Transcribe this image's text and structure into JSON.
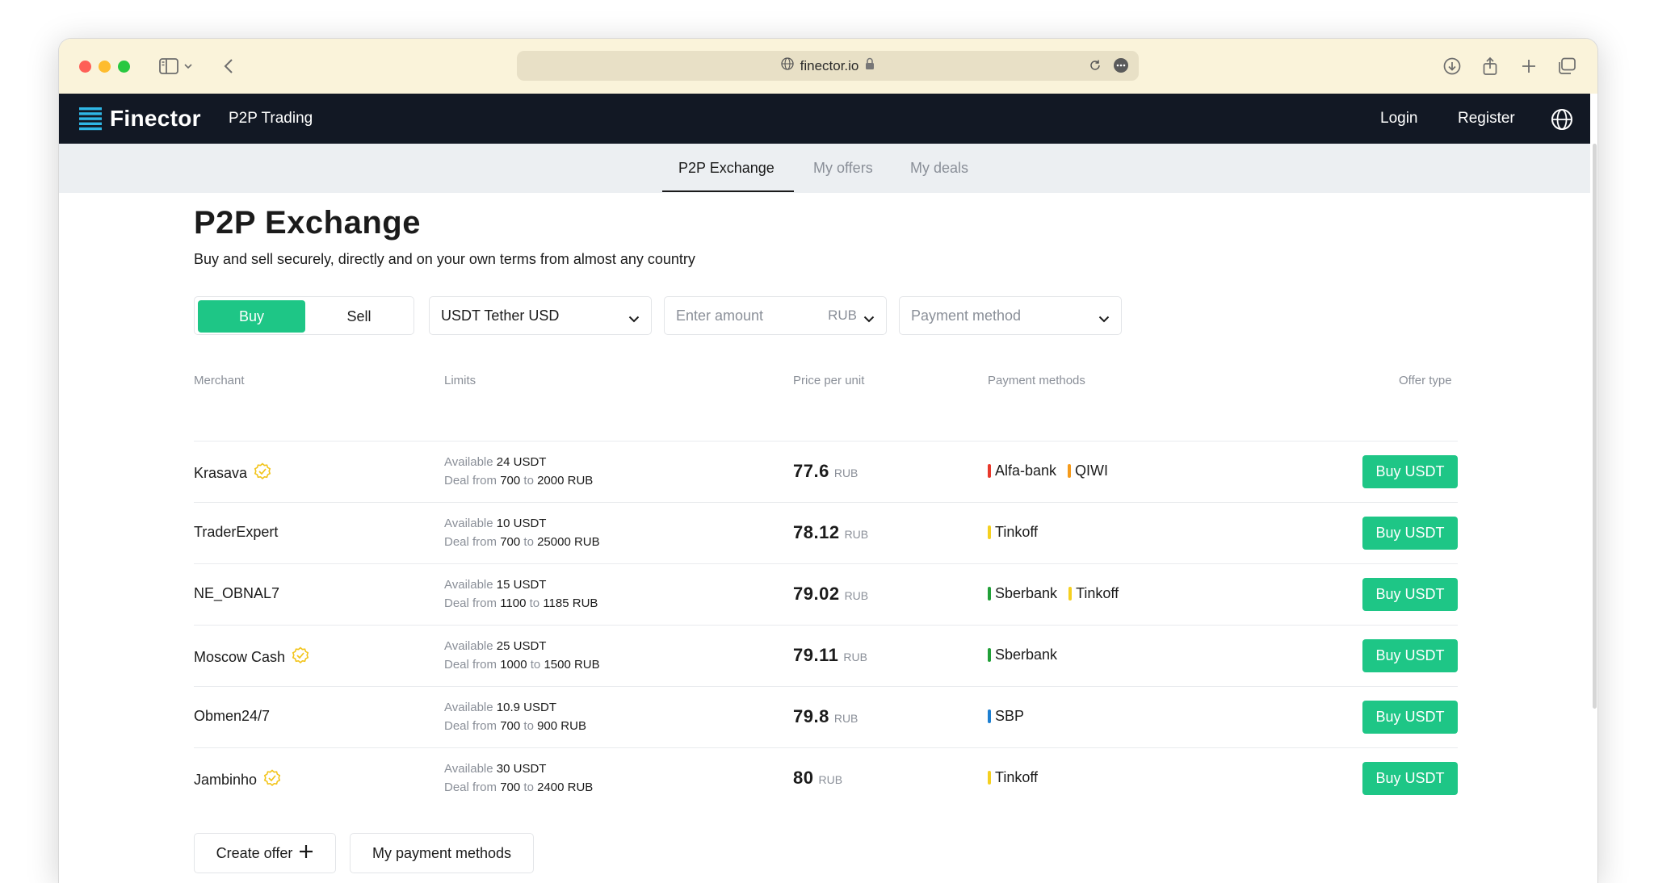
{
  "browser": {
    "url": "finector.io"
  },
  "nav": {
    "brand": "Finector",
    "section": "P2P Trading",
    "login": "Login",
    "register": "Register"
  },
  "tabs": [
    "P2P Exchange",
    "My offers",
    "My deals"
  ],
  "page": {
    "title": "P2P Exchange",
    "subtitle": "Buy and sell securely, directly and on your own terms from almost any country"
  },
  "filters": {
    "buy": "Buy",
    "sell": "Sell",
    "coin": "USDT Tether USD",
    "amount_placeholder": "Enter amount",
    "currency": "RUB",
    "payment_placeholder": "Payment method"
  },
  "table": {
    "headers": [
      "Merchant",
      "Limits",
      "Price per unit",
      "Payment methods",
      "Offer type"
    ],
    "rows": [
      {
        "merchant": "Krasava",
        "verified": true,
        "available_label": "Available",
        "available": "24 USDT",
        "deal_label": "Deal from",
        "from": "700",
        "to_label": "to",
        "to": "2000 RUB",
        "price": "77.6",
        "unit": "RUB",
        "methods": [
          {
            "name": "Alfa-bank",
            "color": "#e8392c"
          },
          {
            "name": "QIWI",
            "color": "#f59b1c"
          }
        ],
        "action": "Buy USDT"
      },
      {
        "merchant": "TraderExpert",
        "verified": false,
        "available_label": "Available",
        "available": "10 USDT",
        "deal_label": "Deal from",
        "from": "700",
        "to_label": "to",
        "to": "25000 RUB",
        "price": "78.12",
        "unit": "RUB",
        "methods": [
          {
            "name": "Tinkoff",
            "color": "#f5d020"
          }
        ],
        "action": "Buy USDT"
      },
      {
        "merchant": "NE_OBNAL7",
        "verified": false,
        "available_label": "Available",
        "available": "15 USDT",
        "deal_label": "Deal from",
        "from": "1100",
        "to_label": "to",
        "to": "1185 RUB",
        "price": "79.02",
        "unit": "RUB",
        "methods": [
          {
            "name": "Sberbank",
            "color": "#21a038"
          },
          {
            "name": "Tinkoff",
            "color": "#f5d020"
          }
        ],
        "action": "Buy USDT"
      },
      {
        "merchant": "Moscow Cash",
        "verified": true,
        "available_label": "Available",
        "available": "25 USDT",
        "deal_label": "Deal from",
        "from": "1000",
        "to_label": "to",
        "to": "1500 RUB",
        "price": "79.11",
        "unit": "RUB",
        "methods": [
          {
            "name": "Sberbank",
            "color": "#21a038"
          }
        ],
        "action": "Buy USDT"
      },
      {
        "merchant": "Obmen24/7",
        "verified": false,
        "available_label": "Available",
        "available": "10.9 USDT",
        "deal_label": "Deal from",
        "from": "700",
        "to_label": "to",
        "to": "900 RUB",
        "price": "79.8",
        "unit": "RUB",
        "methods": [
          {
            "name": "SBP",
            "color": "#1d7fd1"
          }
        ],
        "action": "Buy USDT"
      },
      {
        "merchant": "Jambinho",
        "verified": true,
        "available_label": "Available",
        "available": "30 USDT",
        "deal_label": "Deal from",
        "from": "700",
        "to_label": "to",
        "to": "2400 RUB",
        "price": "80",
        "unit": "RUB",
        "methods": [
          {
            "name": "Tinkoff",
            "color": "#f5d020"
          }
        ],
        "action": "Buy USDT"
      }
    ]
  },
  "footer_buttons": {
    "create": "Create offer",
    "methods": "My payment methods"
  },
  "colors": {
    "accent": "#1ec686",
    "nav_bg": "#121824",
    "verified": "#f2c41b"
  }
}
